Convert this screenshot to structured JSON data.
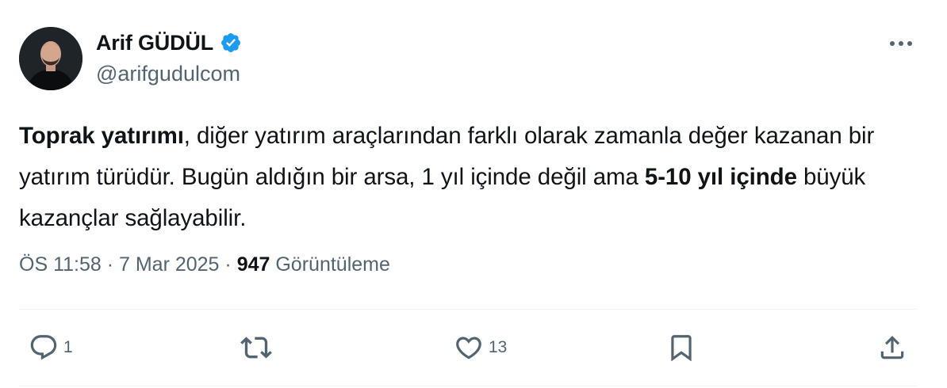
{
  "author": {
    "display_name": "Arif GÜDÜL",
    "handle": "@arifgudulcom",
    "verified": true,
    "avatar_icon": "profile-photo"
  },
  "tweet": {
    "segments": [
      {
        "text": "Toprak yatırımı",
        "bold": true
      },
      {
        "text": ", diğer yatırım araçlarından farklı olarak zamanla değer kazanan bir yatırım türüdür. Bugün aldığın bir arsa, 1 yıl içinde değil ama ",
        "bold": false
      },
      {
        "text": "5-10 yıl içinde",
        "bold": true
      },
      {
        "text": " büyük kazançlar sağlayabilir.",
        "bold": false
      }
    ]
  },
  "meta": {
    "time": "ÖS 11:58",
    "separator": " · ",
    "date": "7 Mar 2025",
    "views_count": "947",
    "views_label": "Görüntüleme"
  },
  "actions": {
    "reply_count": "1",
    "retweet_count": "",
    "like_count": "13"
  },
  "colors": {
    "text": "#0f1419",
    "secondary": "#536471",
    "verified": "#1d9bf0",
    "divider": "#eff3f4"
  },
  "icons": [
    "verified-badge-icon",
    "more-icon",
    "reply-icon",
    "retweet-icon",
    "like-icon",
    "bookmark-icon",
    "share-icon"
  ]
}
